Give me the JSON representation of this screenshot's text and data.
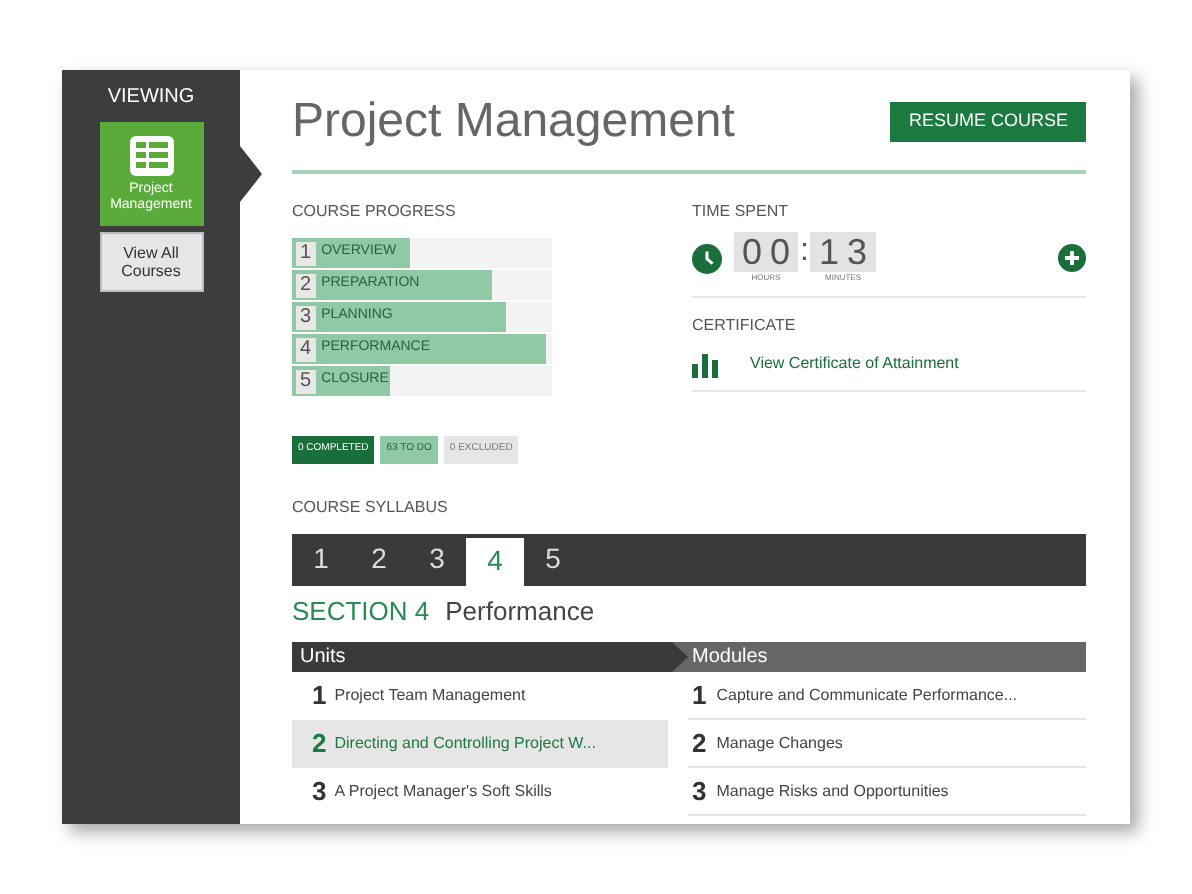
{
  "sidebar": {
    "heading": "VIEWING",
    "course_tile": {
      "label": "Project Management"
    },
    "view_all_button": "View All Courses"
  },
  "header": {
    "title": "Project Management",
    "resume_button": "RESUME COURSE"
  },
  "course_progress": {
    "heading": "COURSE PROGRESS",
    "stages": [
      {
        "number": "1",
        "label": "OVERVIEW",
        "level": 0.45
      },
      {
        "number": "2",
        "label": "PREPARATION",
        "level": 0.77
      },
      {
        "number": "3",
        "label": "PLANNING",
        "level": 0.82
      },
      {
        "number": "4",
        "label": "PERFORMANCE",
        "level": 0.98
      },
      {
        "number": "5",
        "label": "CLOSURE",
        "level": 0.38
      }
    ],
    "status_chips": [
      {
        "kind": "completed",
        "label": "0 COMPLETED"
      },
      {
        "kind": "todo",
        "label": "63 TO DO"
      },
      {
        "kind": "excluded",
        "label": "0 EXCLUDED"
      }
    ]
  },
  "time_spent": {
    "heading": "TIME SPENT",
    "hours": "00",
    "separator": ":",
    "minutes": "13",
    "hours_label": "HOURS",
    "minutes_label": "MINUTES"
  },
  "certificate": {
    "heading": "CERTIFICATE",
    "link": "View Certificate of Attainment"
  },
  "syllabus": {
    "heading": "COURSE SYLLABUS",
    "tabs": [
      {
        "label": "1",
        "selected": false
      },
      {
        "label": "2",
        "selected": false
      },
      {
        "label": "3",
        "selected": false
      },
      {
        "label": "4",
        "selected": true
      },
      {
        "label": "5",
        "selected": false
      }
    ],
    "section_label": "SECTION 4",
    "section_title": "Performance",
    "units_heading": "Units",
    "modules_heading": "Modules",
    "units": [
      {
        "number": "1",
        "title": "Project Team Management",
        "selected": false
      },
      {
        "number": "2",
        "title": "Directing and Controlling Project W...",
        "selected": true
      },
      {
        "number": "3",
        "title": "A Project Manager's Soft Skills",
        "selected": false
      }
    ],
    "modules": [
      {
        "number": "1",
        "title": "Capture and Communicate  Performance..."
      },
      {
        "number": "2",
        "title": "Manage Changes"
      },
      {
        "number": "3",
        "title": "Manage Risks and Opportunities"
      }
    ]
  }
}
